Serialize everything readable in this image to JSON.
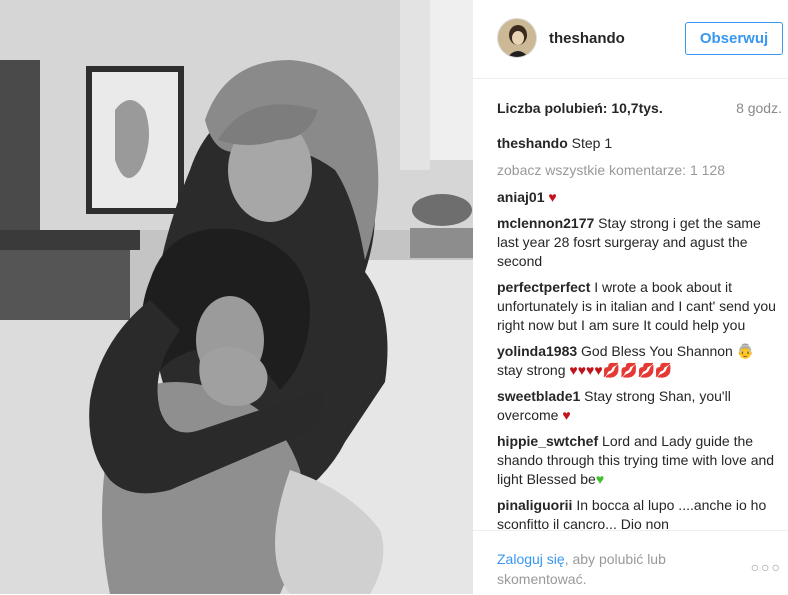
{
  "post": {
    "username": "theshando",
    "follow_label": "Obserwuj",
    "likes_text": "Liczba polubień: 10,7tys.",
    "time_ago": "8 godz.",
    "caption": {
      "user": "theshando",
      "text": "Step 1"
    },
    "view_all": "zobacz wszystkie komentarze: 1 128",
    "comments": [
      {
        "user": "aniaj01",
        "text": "",
        "heart": "♥"
      },
      {
        "user": "mclennon2177",
        "text": "Stay strong i get the same last year 28 fosrt surgeray and agust the second"
      },
      {
        "user": "perfectperfect",
        "text": "I wrote a book about it unfortunately is in italian and I cant' send you right now but I am sure It could help you"
      },
      {
        "user": "yolinda1983",
        "text": "God Bless You Shannon 👵 stay strong",
        "hearts": "♥♥♥♥",
        "kisses": "💋💋💋💋"
      },
      {
        "user": "sweetblade1",
        "text": "Stay strong Shan, you'll overcome",
        "heart": "♥"
      },
      {
        "user": "hippie_swtchef",
        "text": "Lord and Lady guide the shando through this trying time with love and light Blessed be",
        "heart_green": "♥"
      },
      {
        "user": "pinaliguorii",
        "text": "In bocca al lupo ....anche io ho sconfitto il cancro... Dio non"
      }
    ],
    "footer": {
      "login_link": "Zaloguj się",
      "login_rest": ", aby polubić lub skomentować."
    },
    "more_symbol": "○○○"
  }
}
